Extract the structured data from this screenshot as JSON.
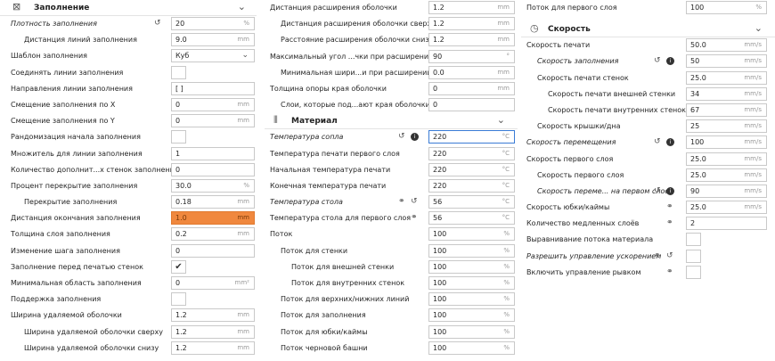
{
  "col1": {
    "section": {
      "title": "Заполнение",
      "icon": "infill-icon"
    },
    "rows": [
      {
        "label": "Плотность заполнения",
        "italic": true,
        "indent": 0,
        "icons": [
          "reset"
        ],
        "type": "field",
        "value": "20",
        "unit": "%"
      },
      {
        "label": "Дистанция линий заполнения",
        "indent": 1,
        "type": "field",
        "value": "9.0",
        "unit": "mm"
      },
      {
        "label": "Шаблон заполнения",
        "indent": 0,
        "type": "select",
        "value": "Куб"
      },
      {
        "label": "Соединять линии заполнения",
        "indent": 0,
        "type": "checkbox",
        "checked": false
      },
      {
        "label": "Направления линии заполнения",
        "indent": 0,
        "type": "field",
        "value": "[ ]",
        "unit": ""
      },
      {
        "label": "Смещение заполнения по X",
        "indent": 0,
        "type": "field",
        "value": "0",
        "unit": "mm"
      },
      {
        "label": "Смещение заполнения по Y",
        "indent": 0,
        "type": "field",
        "value": "0",
        "unit": "mm"
      },
      {
        "label": "Рандомизация начала заполнения",
        "indent": 0,
        "type": "checkbox",
        "checked": false
      },
      {
        "label": "Множитель для линии заполнения",
        "indent": 0,
        "type": "field",
        "value": "1",
        "unit": ""
      },
      {
        "label": "Количество дополнит...х стенок заполнения",
        "indent": 0,
        "type": "field",
        "value": "0",
        "unit": ""
      },
      {
        "label": "Процент перекрытие заполнения",
        "indent": 0,
        "type": "field",
        "value": "30.0",
        "unit": "%"
      },
      {
        "label": "Перекрытие заполнения",
        "indent": 1,
        "type": "field",
        "value": "0.18",
        "unit": "mm"
      },
      {
        "label": "Дистанция окончания заполнения",
        "indent": 0,
        "type": "field",
        "value": "1.0",
        "unit": "mm",
        "highlight": true
      },
      {
        "label": "Толщина слоя заполнения",
        "indent": 0,
        "type": "field",
        "value": "0.2",
        "unit": "mm"
      },
      {
        "label": "Изменение шага заполнения",
        "indent": 0,
        "type": "field",
        "value": "0",
        "unit": ""
      },
      {
        "label": "Заполнение перед печатью стенок",
        "indent": 0,
        "type": "checkbox",
        "checked": true
      },
      {
        "label": "Минимальная область заполнения",
        "indent": 0,
        "type": "field",
        "value": "0",
        "unit": "mm²"
      },
      {
        "label": "Поддержка заполнения",
        "indent": 0,
        "type": "checkbox",
        "checked": false
      },
      {
        "label": "Ширина удаляемой оболочки",
        "indent": 0,
        "type": "field",
        "value": "1.2",
        "unit": "mm"
      },
      {
        "label": "Ширина удаляемой оболочки сверху",
        "indent": 1,
        "type": "field",
        "value": "1.2",
        "unit": "mm"
      },
      {
        "label": "Ширина удаляемой оболочки снизу",
        "indent": 1,
        "type": "field",
        "value": "1.2",
        "unit": "mm"
      }
    ]
  },
  "col2": {
    "rows_top": [
      {
        "label": "Дистанция расширения оболочки",
        "indent": 0,
        "type": "field",
        "value": "1.2",
        "unit": "mm"
      },
      {
        "label": "Дистанция расширения оболочки сверху",
        "indent": 1,
        "type": "field",
        "value": "1.2",
        "unit": "mm"
      },
      {
        "label": "Расстояние расширения оболочки снизу",
        "indent": 1,
        "type": "field",
        "value": "1.2",
        "unit": "mm"
      },
      {
        "label": "Максимальный угол ...чки при расширении",
        "indent": 0,
        "type": "field",
        "value": "90",
        "unit": "°"
      },
      {
        "label": "Минимальная шири...и при расширении",
        "indent": 1,
        "type": "field",
        "value": "0.0",
        "unit": "mm"
      },
      {
        "label": "Толщина опоры края оболочки",
        "indent": 0,
        "type": "field",
        "value": "0",
        "unit": "mm"
      },
      {
        "label": "Слои, которые под...ают края оболочки",
        "indent": 1,
        "type": "field",
        "value": "0",
        "unit": ""
      }
    ],
    "section": {
      "title": "Материал",
      "icon": "material-icon"
    },
    "rows": [
      {
        "label": "Температура сопла",
        "italic": true,
        "indent": 0,
        "icons": [
          "reset",
          "info"
        ],
        "type": "field",
        "value": "220",
        "unit": "°C",
        "active": true
      },
      {
        "label": "Температура печати первого слоя",
        "indent": 0,
        "type": "field",
        "value": "220",
        "unit": "°C"
      },
      {
        "label": "Начальная температура печати",
        "indent": 0,
        "type": "field",
        "value": "220",
        "unit": "°C"
      },
      {
        "label": "Конечная температура печати",
        "indent": 0,
        "type": "field",
        "value": "220",
        "unit": "°C"
      },
      {
        "label": "Температура стола",
        "italic": true,
        "indent": 0,
        "icons": [
          "link",
          "reset"
        ],
        "type": "field",
        "value": "56",
        "unit": "°C"
      },
      {
        "label": "Температура стола для первого слоя",
        "indent": 0,
        "icons": [
          "link"
        ],
        "type": "field",
        "value": "56",
        "unit": "°C"
      },
      {
        "label": "Поток",
        "indent": 0,
        "type": "field",
        "value": "100",
        "unit": "%"
      },
      {
        "label": "Поток для стенки",
        "indent": 1,
        "type": "field",
        "value": "100",
        "unit": "%"
      },
      {
        "label": "Поток для внешней стенки",
        "indent": 2,
        "type": "field",
        "value": "100",
        "unit": "%"
      },
      {
        "label": "Поток для внутренних стенок",
        "indent": 2,
        "type": "field",
        "value": "100",
        "unit": "%"
      },
      {
        "label": "Поток для верхних/нижних линий",
        "indent": 1,
        "type": "field",
        "value": "100",
        "unit": "%"
      },
      {
        "label": "Поток для заполнения",
        "indent": 1,
        "type": "field",
        "value": "100",
        "unit": "%"
      },
      {
        "label": "Поток для юбки/каймы",
        "indent": 1,
        "type": "field",
        "value": "100",
        "unit": "%"
      },
      {
        "label": "Поток черновой башни",
        "indent": 1,
        "type": "field",
        "value": "100",
        "unit": "%"
      }
    ]
  },
  "col3": {
    "rows_top": [
      {
        "label": "Поток для первого слоя",
        "indent": 0,
        "type": "field",
        "value": "100",
        "unit": "%"
      }
    ],
    "section": {
      "title": "Скорость",
      "icon": "speed-icon"
    },
    "rows": [
      {
        "label": "Скорость печати",
        "indent": 0,
        "type": "field",
        "value": "50.0",
        "unit": "mm/s"
      },
      {
        "label": "Скорость заполнения",
        "italic": true,
        "indent": 1,
        "icons": [
          "reset",
          "info"
        ],
        "type": "field",
        "value": "50",
        "unit": "mm/s"
      },
      {
        "label": "Скорость печати стенок",
        "indent": 1,
        "type": "field",
        "value": "25.0",
        "unit": "mm/s"
      },
      {
        "label": "Скорость печати внешней стенки",
        "indent": 2,
        "type": "field",
        "value": "34",
        "unit": "mm/s"
      },
      {
        "label": "Скорость печати внутренних стенок",
        "indent": 2,
        "type": "field",
        "value": "67",
        "unit": "mm/s"
      },
      {
        "label": "Скорость крышки/дна",
        "indent": 1,
        "type": "field",
        "value": "25",
        "unit": "mm/s"
      },
      {
        "label": "Скорость перемещения",
        "italic": true,
        "indent": 0,
        "icons": [
          "reset",
          "info"
        ],
        "type": "field",
        "value": "100",
        "unit": "mm/s"
      },
      {
        "label": "Скорость первого слоя",
        "indent": 0,
        "type": "field",
        "value": "25.0",
        "unit": "mm/s"
      },
      {
        "label": "Скорость первого слоя",
        "indent": 1,
        "type": "field",
        "value": "25.0",
        "unit": "mm/s"
      },
      {
        "label": "Скорость переме... на первом слое",
        "italic": true,
        "indent": 1,
        "icons": [
          "reset",
          "info"
        ],
        "type": "field",
        "value": "90",
        "unit": "mm/s"
      },
      {
        "label": "Скорость юбки/каймы",
        "indent": 0,
        "icons": [
          "link"
        ],
        "type": "field",
        "value": "25.0",
        "unit": "mm/s"
      },
      {
        "label": "Количество медленных слоёв",
        "indent": 0,
        "icons": [
          "link"
        ],
        "type": "field",
        "value": "2",
        "unit": ""
      },
      {
        "label": "Выравнивание потока материала",
        "indent": 0,
        "type": "checkbox",
        "checked": false
      },
      {
        "label": "Разрешить управление ускорением",
        "italic": true,
        "indent": 0,
        "icons": [
          "link",
          "reset"
        ],
        "type": "checkbox",
        "checked": false
      },
      {
        "label": "Включить управление рывком",
        "indent": 0,
        "icons": [
          "link"
        ],
        "type": "checkbox",
        "checked": false
      }
    ]
  },
  "glyphs": {
    "reset": "↺",
    "info": "i",
    "link": "⚭",
    "check": "✔",
    "chevron": "⌄",
    "select_arrow": "⌄"
  }
}
